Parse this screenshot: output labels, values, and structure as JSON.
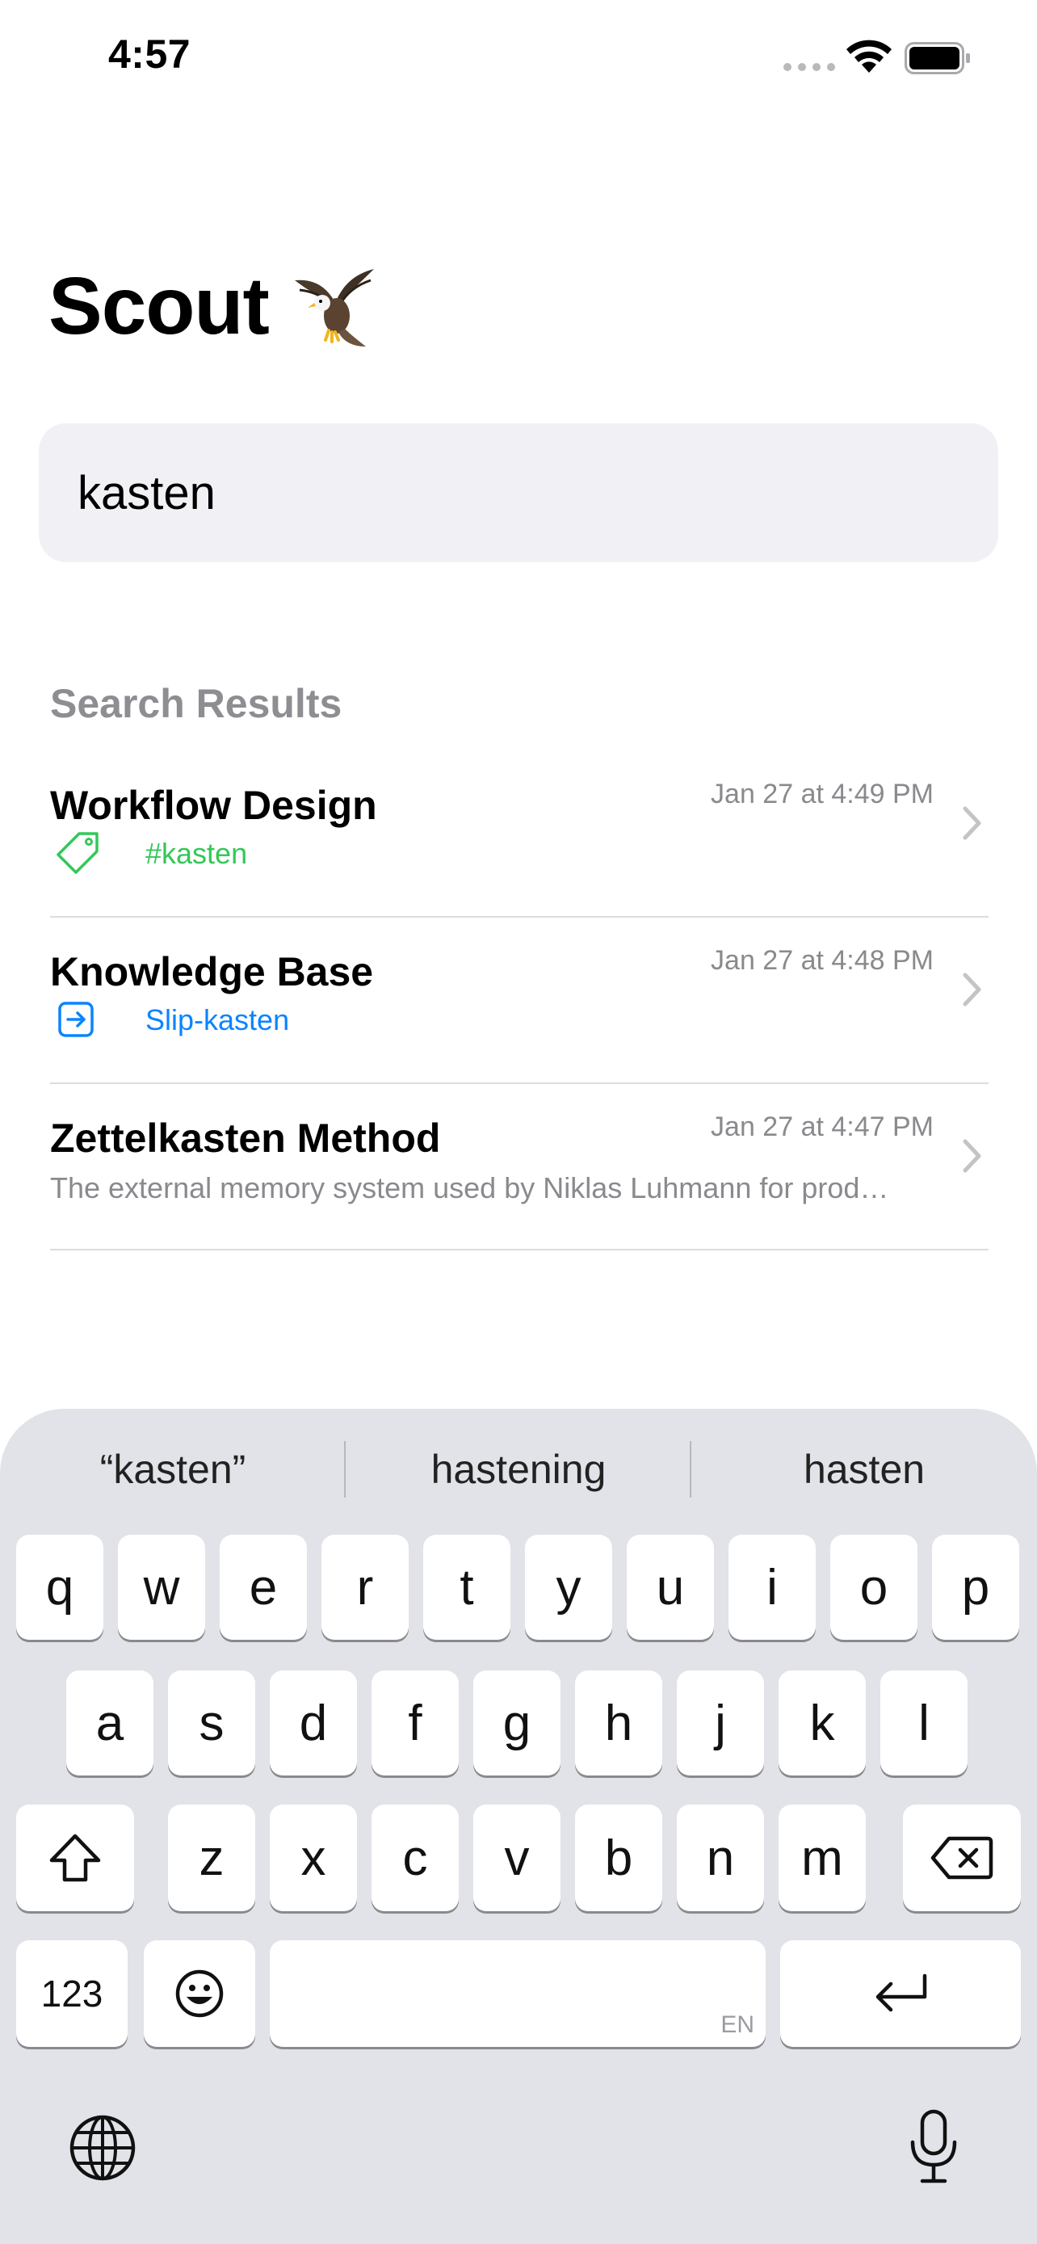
{
  "status_bar": {
    "time": "4:57"
  },
  "header": {
    "title": "Scout",
    "logo_icon": "eagle-icon"
  },
  "search": {
    "value": "kasten",
    "placeholder": ""
  },
  "results": {
    "section_title": "Search Results",
    "items": [
      {
        "title": "Workflow Design",
        "date": "Jan 27 at 4:49 PM",
        "subtitle": "#kasten",
        "subtitle_color": "#34c759",
        "icon": "tag-icon"
      },
      {
        "title": "Knowledge Base",
        "date": "Jan 27 at 4:48 PM",
        "subtitle": "Slip-kasten",
        "subtitle_color": "#0a84ff",
        "icon": "link-arrow-icon"
      },
      {
        "title": "Zettelkasten Method",
        "date": "Jan 27 at 4:47 PM",
        "description": "The external memory system used by Niklas Luhmann for prod…"
      }
    ]
  },
  "keyboard": {
    "suggestions": [
      "“kasten”",
      "hastening",
      "hasten"
    ],
    "row1": [
      "q",
      "w",
      "e",
      "r",
      "t",
      "y",
      "u",
      "i",
      "o",
      "p"
    ],
    "row2": [
      "a",
      "s",
      "d",
      "f",
      "g",
      "h",
      "j",
      "k",
      "l"
    ],
    "row3": [
      "z",
      "x",
      "c",
      "v",
      "b",
      "n",
      "m"
    ],
    "numbers_label": "123",
    "space_language": "EN"
  }
}
